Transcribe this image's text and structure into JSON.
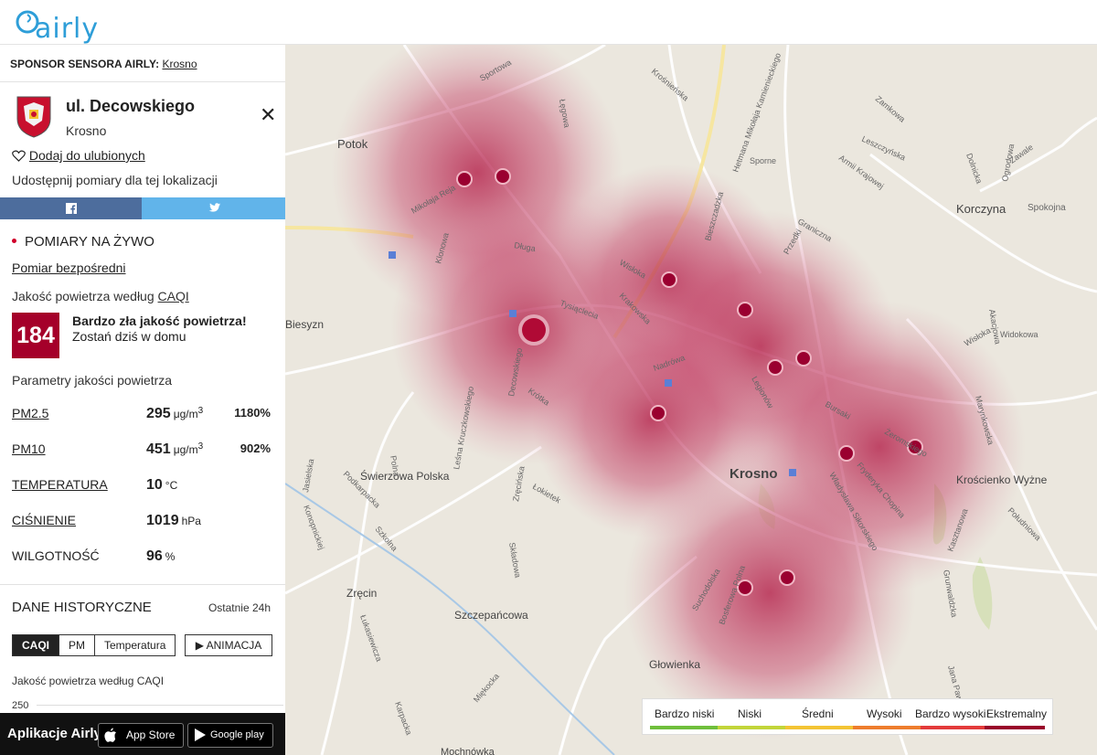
{
  "header": {
    "logo_text": "airly"
  },
  "sidebar": {
    "sponsor_label": "SPONSOR SENSORA AIRLY:",
    "sponsor_link": "Krosno",
    "location_title": "ul. Decowskiego",
    "location_city": "Krosno",
    "favorite_label": "Dodaj do ulubionych",
    "share_label": "Udostępnij pomiary dla tej lokalizacji",
    "live_label": "POMIARY NA ŻYWO",
    "direct_label": "Pomiar bezpośredni",
    "caqi_prefix": "Jakość powietrza według",
    "caqi_link": "CAQI",
    "aqi_value": "184",
    "aqi_message_bold": "Bardzo zła jakość powietrza!",
    "aqi_message": "Zostań dziś w domu",
    "aqi_color": "#a5002a",
    "params_title": "Parametry jakości powietrza",
    "params": [
      {
        "name": "PM2.5",
        "value": "295",
        "unit": "μg/m",
        "sup": "3",
        "percent": "1180%"
      },
      {
        "name": "PM10",
        "value": "451",
        "unit": "μg/m",
        "sup": "3",
        "percent": "902%"
      },
      {
        "name": "TEMPERATURA",
        "value": "10",
        "unit": "°C",
        "sup": "",
        "percent": ""
      },
      {
        "name": "CIŚNIENIE",
        "value": "1019",
        "unit": "hPa",
        "sup": "",
        "percent": ""
      },
      {
        "name": "WILGOTNOŚĆ",
        "value": "96",
        "unit": "%",
        "sup": "",
        "percent": ""
      }
    ],
    "history_title": "DANE HISTORYCZNE",
    "history_range": "Ostatnie 24h",
    "tabs": [
      "CAQI",
      "PM",
      "Temperatura"
    ],
    "animation_label": "▶ ANIMACJA",
    "chart_label": "Jakość powietrza według CAQI",
    "chart_tick": "250",
    "apps_label": "Aplikacje Airly",
    "app_store": "App Store",
    "google_play": "Google play"
  },
  "map": {
    "places": [
      {
        "name": "Potok"
      },
      {
        "name": "Korczyna"
      },
      {
        "name": "Spokojna"
      },
      {
        "name": "Krosno"
      },
      {
        "name": "Świerzowa Polska"
      },
      {
        "name": "Krościenko Wyżne"
      },
      {
        "name": "Zręcin"
      },
      {
        "name": "Szczepańcowa"
      },
      {
        "name": "Głowienka"
      },
      {
        "name": "Biesyzn"
      },
      {
        "name": "Mochnówka"
      }
    ],
    "streets": [
      "Sportowa",
      "Krośnieńska",
      "Łęgowa",
      "Hetmana Mikołaja Kamienieckiego",
      "Zamkowa",
      "Leszczyńska",
      "Armii Krajowej",
      "Sporne",
      "Graniczna",
      "Dolnicka",
      "Zawale",
      "Ogrodowa",
      "Mikołaja Reja",
      "Klonowa",
      "Długa",
      "Wisłoka",
      "Bieszczadzka",
      "Przedki",
      "Akacjowa",
      "Tysiąclecia",
      "Krakowska",
      "Legionów",
      "Wisłoka",
      "Widokowa",
      "Nadrówa",
      "Decowskiego",
      "Krótka",
      "Bursaki",
      "Żeromskiego",
      "Marynkowska",
      "Leśna Kruczkowskiego",
      "Szkolna",
      "Podkarpacka",
      "Jasielska",
      "Fryderyka Chopina",
      "Zręcińska",
      "Łokietek",
      "Składowa",
      "Polna",
      "Władysława Sikorskiego",
      "Kasztanowa",
      "Południowa",
      "Grunwaldzka",
      "Suchodolska",
      "Bosferowa Polna",
      "Jana Pawła II",
      "Karpacka",
      "Łukasiewicza",
      "Konopnickiej",
      "Miękocka"
    ]
  },
  "legend": {
    "items": [
      {
        "label": "Bardzo niski",
        "color": "#6fbf3c"
      },
      {
        "label": "Niski",
        "color": "#c2d53a"
      },
      {
        "label": "Średni",
        "color": "#f3c434"
      },
      {
        "label": "Wysoki",
        "color": "#ee7d2d"
      },
      {
        "label": "Bardzo wysoki",
        "color": "#e33b3b"
      },
      {
        "label": "Ekstremalny",
        "color": "#99002a"
      }
    ]
  }
}
